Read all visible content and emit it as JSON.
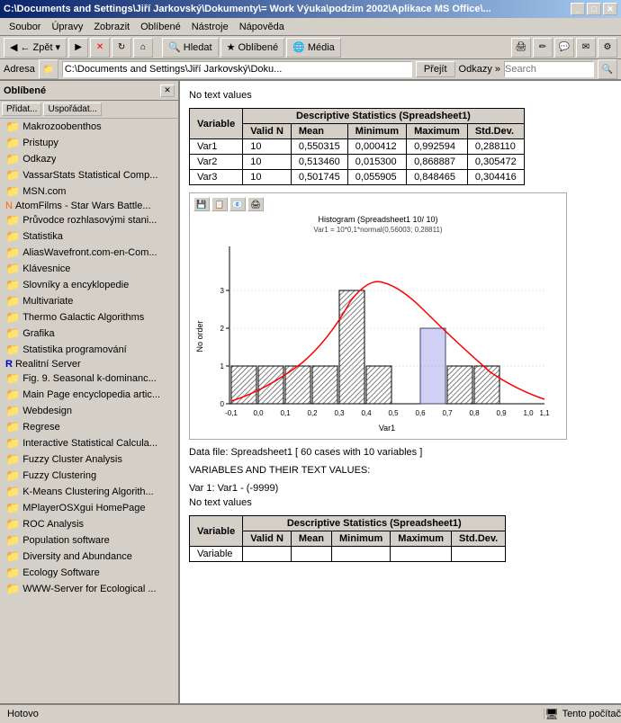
{
  "titlebar": {
    "text": "C:\\Documents and Settings\\Jiří Jarkovský\\Dokumenty\\= Work Výuka\\podzim 2002\\Aplikace MS Office\\...",
    "minimize": "_",
    "maximize": "□",
    "close": "✕"
  },
  "menubar": {
    "items": [
      "Soubor",
      "Úpravy",
      "Zobrazit",
      "Oblíbené",
      "Nástroje",
      "Nápověda"
    ]
  },
  "toolbar": {
    "back": "← Zpět",
    "forward": "→",
    "stop": "✕",
    "refresh": "↻",
    "home": "⌂",
    "search": "Hledat",
    "favorites": "Oblíbené",
    "media": "Média"
  },
  "addressbar": {
    "label": "Adresa",
    "value": "C:\\Documents and Settings\\Jiří Jarkovský\\Doku...",
    "go": "Přejít",
    "links": "Odkazy »",
    "search_placeholder": "Search"
  },
  "sidebar": {
    "title": "Oblíbené",
    "add": "Přidat...",
    "organize": "Uspořádat...",
    "items": [
      {
        "icon": "folder",
        "label": "Makrozoobenthos"
      },
      {
        "icon": "folder",
        "label": "Pristupy"
      },
      {
        "icon": "folder",
        "label": "Odkazy"
      },
      {
        "icon": "folder",
        "label": "VassarStats Statistical Comp..."
      },
      {
        "icon": "folder",
        "label": "MSN.com"
      },
      {
        "icon": "special",
        "label": "AtomFilms - Star Wars Battle..."
      },
      {
        "icon": "folder",
        "label": "Průvodce rozhlasovými stani..."
      },
      {
        "icon": "folder",
        "label": "Statistika"
      },
      {
        "icon": "folder",
        "label": "AliasWavefront.com-en-Com..."
      },
      {
        "icon": "folder",
        "label": "Klávesnice"
      },
      {
        "icon": "folder",
        "label": "Slovníky a encyklopedie"
      },
      {
        "icon": "folder",
        "label": "Multivariate"
      },
      {
        "icon": "folder",
        "label": "Thermo Galactic Algorithms"
      },
      {
        "icon": "folder",
        "label": "Grafika"
      },
      {
        "icon": "folder",
        "label": "Statistika programování"
      },
      {
        "icon": "special2",
        "label": "Realitní Server"
      },
      {
        "icon": "folder",
        "label": "Fig. 9. Seasonal k-dominanc..."
      },
      {
        "icon": "folder",
        "label": "Main Page encyclopedia artic..."
      },
      {
        "icon": "folder",
        "label": "Webdesign"
      },
      {
        "icon": "folder",
        "label": "Regrese"
      },
      {
        "icon": "folder",
        "label": "Interactive Statistical Calcula..."
      },
      {
        "icon": "folder",
        "label": "Fuzzy Cluster Analysis"
      },
      {
        "icon": "folder",
        "label": "Fuzzy Clustering"
      },
      {
        "icon": "folder",
        "label": "K-Means Clustering Algorith..."
      },
      {
        "icon": "folder",
        "label": "MPlayerOSXgui HomePage"
      },
      {
        "icon": "folder",
        "label": "ROC Analysis"
      },
      {
        "icon": "folder",
        "label": "Population software"
      },
      {
        "icon": "folder",
        "label": "Diversity and Abundance"
      },
      {
        "icon": "folder",
        "label": "Ecology Software"
      },
      {
        "icon": "folder",
        "label": "WWW-Server for Ecological ..."
      }
    ]
  },
  "content": {
    "no_text_values": "No text values",
    "stats_table1": {
      "title": "Descriptive Statistics (Spreadsheet1)",
      "headers": [
        "Variable",
        "Valid N",
        "Mean",
        "Minimum",
        "Maximum",
        "Std.Dev."
      ],
      "rows": [
        [
          "Var1",
          "10",
          "0,550315",
          "0,000412",
          "0,992594",
          "0,288110"
        ],
        [
          "Var2",
          "10",
          "0,513460",
          "0,015300",
          "0,868887",
          "0,305472"
        ],
        [
          "Var3",
          "10",
          "0,501745",
          "0,055905",
          "0,848465",
          "0,304416"
        ]
      ]
    },
    "histogram": {
      "title": "Histogram (Spreadsheet1 10/ 10)",
      "subtitle": "Var1 = 10*0,1*normal(0,56003; 0,28811)",
      "xlabel": "Var1",
      "ylabel": "No order"
    },
    "data_file_info": "Data file: Spreadsheet1 [ 60 cases with 10 variables ]",
    "variables_header": "VARIABLES AND THEIR TEXT VALUES:",
    "var1_label": "Var 1: Var1 - (-9999)",
    "no_text_values2": "No text values",
    "stats_table2": {
      "title": "Descriptive Statistics (Spreadsheet1)",
      "headers": [
        "Variable",
        "Valid N",
        "Mean",
        "Minimum",
        "Maximum",
        "Std.Dev."
      ],
      "rows": []
    }
  },
  "statusbar": {
    "left": "Hotovo",
    "right": "Tento počítač"
  }
}
